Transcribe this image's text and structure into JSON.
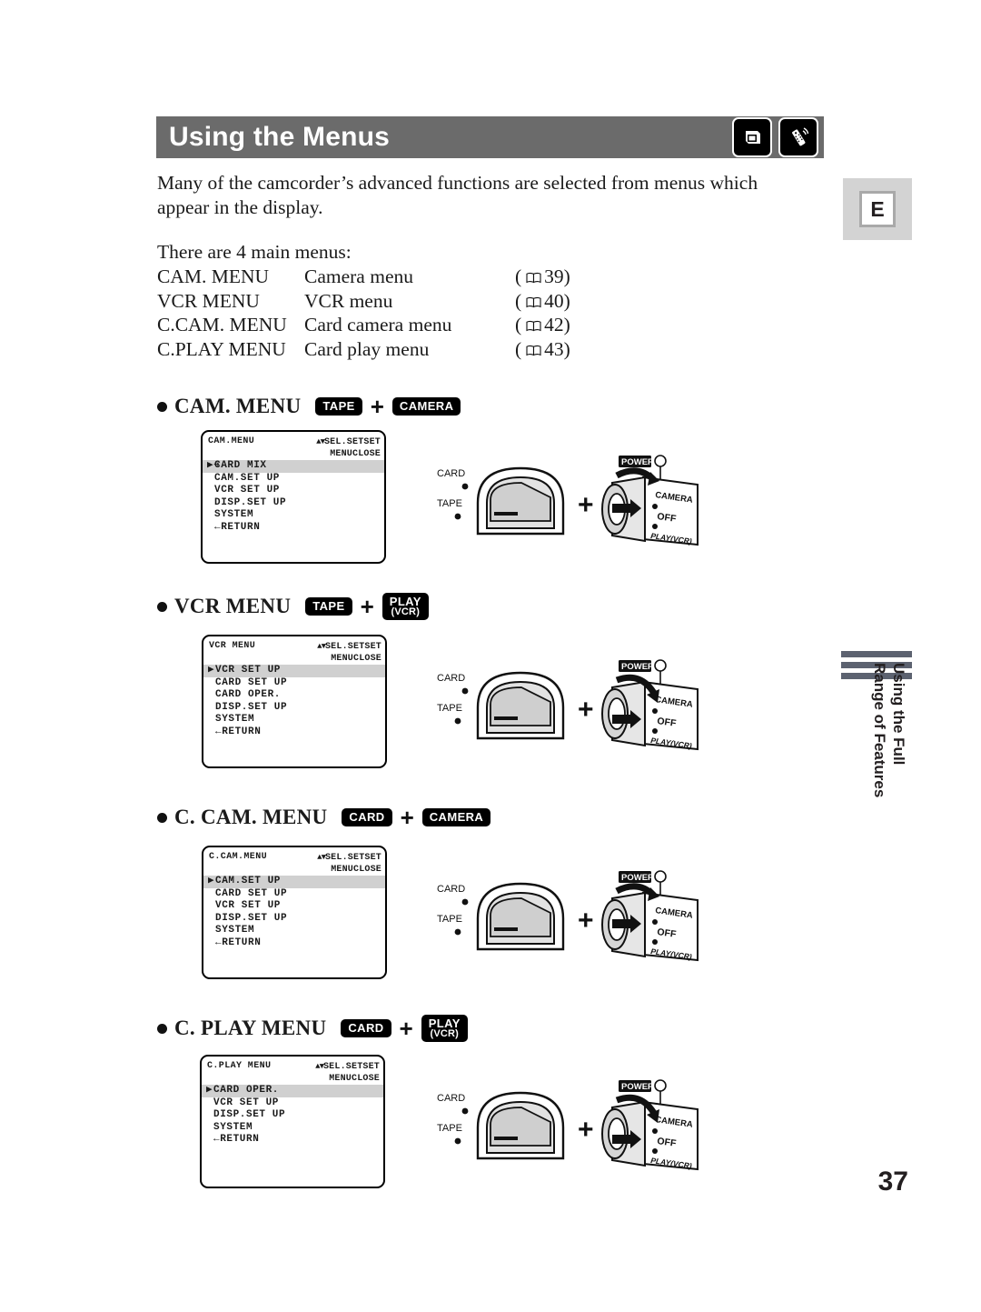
{
  "header": {
    "title": "Using the Menus",
    "icons": [
      "card-tape-icon",
      "remote-control-icon"
    ]
  },
  "language_marker": "E",
  "intro": {
    "paragraph": "Many of the camcorder’s advanced functions are selected from menus which appear in the display.",
    "subheading": "There are 4 main menus:"
  },
  "menu_list": [
    {
      "name": "CAM. MENU",
      "description": "Camera menu",
      "ref_open": "(",
      "page": "39",
      "ref_close": ")"
    },
    {
      "name": "VCR MENU",
      "description": "VCR menu",
      "ref_open": "(",
      "page": "40",
      "ref_close": ")"
    },
    {
      "name": "C.CAM. MENU",
      "description": "Card camera menu",
      "ref_open": "(",
      "page": "42",
      "ref_close": ")"
    },
    {
      "name": "C.PLAY MENU",
      "description": "Card play menu",
      "ref_open": "(",
      "page": "43",
      "ref_close": ")"
    }
  ],
  "sections": [
    {
      "title": "CAM. MENU",
      "badge1": {
        "line1": "TAPE",
        "line2": ""
      },
      "plus": "+",
      "badge2": {
        "line1": "CAMERA",
        "line2": ""
      },
      "lcd": {
        "title": "CAM.MENU",
        "hint_arrows": "▲▼",
        "hint_line1": "SEL.SETSET",
        "hint_line2": "MENUCLOSE",
        "items": [
          {
            "cursor": "▶➔",
            "label": "CARD MIX",
            "selected": true
          },
          {
            "cursor": "",
            "label": "CAM.SET UP",
            "selected": false
          },
          {
            "cursor": "",
            "label": "VCR SET UP",
            "selected": false
          },
          {
            "cursor": "",
            "label": "DISP.SET UP",
            "selected": false
          },
          {
            "cursor": "",
            "label": "SYSTEM",
            "selected": false
          },
          {
            "cursor": "",
            "label": "←RETURN",
            "selected": false
          }
        ]
      },
      "dial": {
        "card_label": "CARD",
        "tape_label": "TAPE",
        "power_label": "POWER",
        "camera_label": "CAMERA",
        "off_label": "OFF",
        "play_label": "PLAY(VCR)",
        "plus": "+",
        "selected_position": "CAMERA"
      }
    },
    {
      "title": "VCR MENU",
      "badge1": {
        "line1": "TAPE",
        "line2": ""
      },
      "plus": "+",
      "badge2": {
        "line1": "PLAY",
        "line2": "(VCR)"
      },
      "lcd": {
        "title": "VCR MENU",
        "hint_arrows": "▲▼",
        "hint_line1": "SEL.SETSET",
        "hint_line2": "MENUCLOSE",
        "items": [
          {
            "cursor": "▶",
            "label": "VCR SET UP",
            "selected": true
          },
          {
            "cursor": "",
            "label": "CARD SET UP",
            "selected": false
          },
          {
            "cursor": "",
            "label": "CARD OPER.",
            "selected": false
          },
          {
            "cursor": "",
            "label": "DISP.SET UP",
            "selected": false
          },
          {
            "cursor": "",
            "label": "SYSTEM",
            "selected": false
          },
          {
            "cursor": "",
            "label": "←RETURN",
            "selected": false
          }
        ]
      },
      "dial": {
        "card_label": "CARD",
        "tape_label": "TAPE",
        "power_label": "POWER",
        "camera_label": "CAMERA",
        "off_label": "OFF",
        "play_label": "PLAY(VCR)",
        "plus": "+",
        "selected_position": "PLAY"
      }
    },
    {
      "title": "C. CAM. MENU",
      "badge1": {
        "line1": "CARD",
        "line2": ""
      },
      "plus": "+",
      "badge2": {
        "line1": "CAMERA",
        "line2": ""
      },
      "lcd": {
        "title": "C.CAM.MENU",
        "hint_arrows": "▲▼",
        "hint_line1": "SEL.SETSET",
        "hint_line2": "MENUCLOSE",
        "items": [
          {
            "cursor": "▶",
            "label": "CAM.SET UP",
            "selected": true
          },
          {
            "cursor": "",
            "label": "CARD SET UP",
            "selected": false
          },
          {
            "cursor": "",
            "label": "VCR SET UP",
            "selected": false
          },
          {
            "cursor": "",
            "label": "DISP.SET UP",
            "selected": false
          },
          {
            "cursor": "",
            "label": "SYSTEM",
            "selected": false
          },
          {
            "cursor": "",
            "label": "←RETURN",
            "selected": false
          }
        ]
      },
      "dial": {
        "card_label": "CARD",
        "tape_label": "TAPE",
        "power_label": "POWER",
        "camera_label": "CAMERA",
        "off_label": "OFF",
        "play_label": "PLAY(VCR)",
        "plus": "+",
        "selected_position": "CAMERA"
      }
    },
    {
      "title": "C. PLAY MENU",
      "badge1": {
        "line1": "CARD",
        "line2": ""
      },
      "plus": "+",
      "badge2": {
        "line1": "PLAY",
        "line2": "(VCR)"
      },
      "lcd": {
        "title": "C.PLAY MENU",
        "hint_arrows": "▲▼",
        "hint_line1": "SEL.SETSET",
        "hint_line2": "MENUCLOSE",
        "items": [
          {
            "cursor": "▶",
            "label": "CARD OPER.",
            "selected": true
          },
          {
            "cursor": "",
            "label": "VCR SET UP",
            "selected": false
          },
          {
            "cursor": "",
            "label": "DISP.SET UP",
            "selected": false
          },
          {
            "cursor": "",
            "label": "SYSTEM",
            "selected": false
          },
          {
            "cursor": "",
            "label": "←RETURN",
            "selected": false
          }
        ]
      },
      "dial": {
        "card_label": "CARD",
        "tape_label": "TAPE",
        "power_label": "POWER",
        "camera_label": "CAMERA",
        "off_label": "OFF",
        "play_label": "PLAY(VCR)",
        "plus": "+",
        "selected_position": "PLAY"
      }
    }
  ],
  "side_tab": {
    "line1": "Using the Full",
    "line2": "Range of Features"
  },
  "page_number": "37",
  "colors": {
    "header_bar": "#6b6b6b",
    "side_tab_bar": "#5c6270",
    "e_box": "#d3d3d3",
    "lcd_highlight": "#d0d0d0"
  }
}
